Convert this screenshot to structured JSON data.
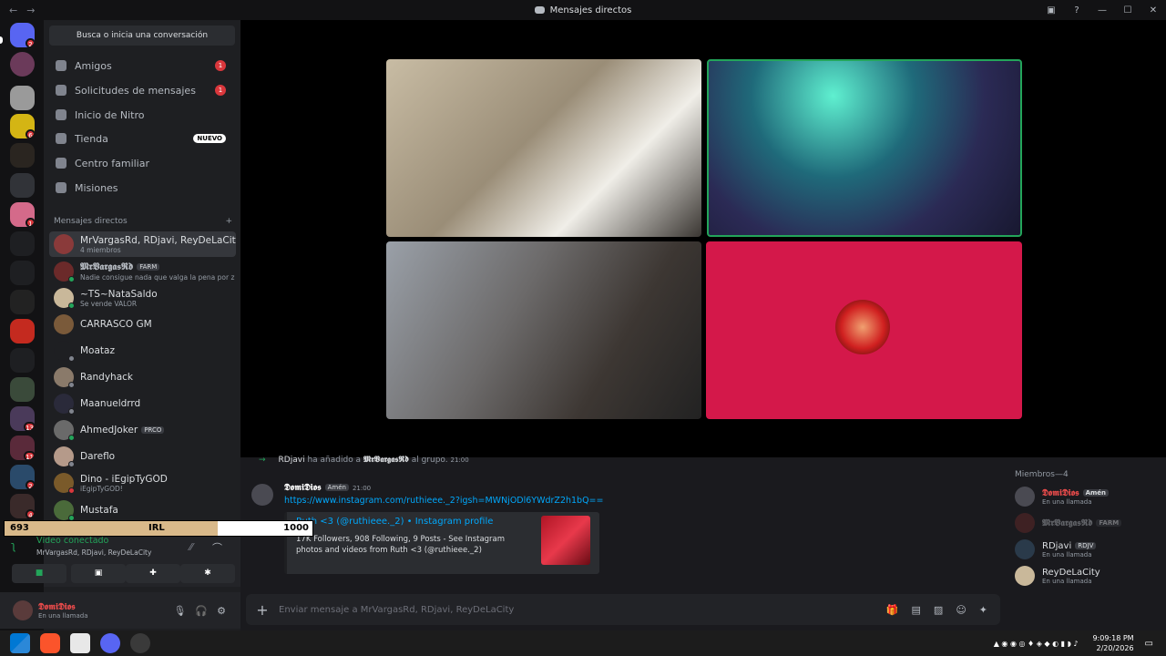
{
  "titlebar": {
    "title": "Mensajes directos",
    "back": "←",
    "forward": "→"
  },
  "search": {
    "placeholder": "Busca o inicia una conversación"
  },
  "nav": [
    {
      "label": "Amigos",
      "count": "1"
    },
    {
      "label": "Solicitudes de mensajes",
      "count": "1"
    },
    {
      "label": "Inicio de Nitro"
    },
    {
      "label": "Tienda",
      "badge": "NUEVO"
    },
    {
      "label": "Centro familiar"
    },
    {
      "label": "Misiones"
    }
  ],
  "dm_header": "Mensajes directos",
  "dms": [
    {
      "name": "MrVargasRd, RDjavi, ReyDeLaCity",
      "sub": "4 miembros"
    },
    {
      "name": "𝕸𝖗𝖁𝖆𝖗𝖌𝖆𝖘𝕽𝖉",
      "tag": "FARM",
      "sub": "Nadie consigue nada que valga la pena por z"
    },
    {
      "name": "~TS~NataSaldo",
      "sub": "Se vende VALOR"
    },
    {
      "name": "CARRASCO GM"
    },
    {
      "name": "Moataz"
    },
    {
      "name": "Randyhack"
    },
    {
      "name": "Maanueldrrd"
    },
    {
      "name": "AhmedJoker",
      "tag": "PRCO"
    },
    {
      "name": "Dareflo"
    },
    {
      "name": "Dino - iEgipTyGOD",
      "sub": "iEgipTyGOD!"
    },
    {
      "name": "Mustafa"
    }
  ],
  "voice": {
    "status": "Vídeo conectado",
    "channel": "MrVargasRd, RDjavi, ReyDeLaCity"
  },
  "user": {
    "name": "𝕯𝖔𝖒𝖎𝕯𝖎𝖔𝖘",
    "status": "En una llamada"
  },
  "progress": {
    "left": "693",
    "center": "IRL",
    "right": "1000",
    "value": 693,
    "max": 1000
  },
  "chat": {
    "system_actor": "RDjavi",
    "system_text": "ha añadido a",
    "system_target": "𝕸𝖗𝖁𝖆𝖗𝖌𝖆𝖘𝕽𝖉",
    "system_suffix": "al grupo.",
    "system_time": "21:00",
    "author": "𝕯𝖔𝖒𝖎𝕯𝖎𝖔𝖘",
    "author_tag": "Amén",
    "time": "21:00",
    "link": "https://www.instagram.com/ruthieee._2?igsh=MWNjODl6YWdrZ2h1bQ==",
    "embed_title": "Ruth <3 (@ruthieee._2) • Instagram profile",
    "embed_desc": "17K Followers, 908 Following, 9 Posts - See Instagram photos and videos from Ruth <3 (@ruthieee._2)"
  },
  "composer": {
    "placeholder": "Enviar mensaje a MrVargasRd, RDjavi, ReyDeLaCity"
  },
  "members": {
    "header": "Miembros—4",
    "list": [
      {
        "name": "𝕯𝖔𝖒𝖎𝕯𝖎𝖔𝖘",
        "tag": "Amén",
        "sub": "En una llamada",
        "color": "#e94b4b"
      },
      {
        "name": "𝕸𝖗𝖁𝖆𝖗𝖌𝖆𝖘𝕽𝖉",
        "tag": "FARM",
        "sub": "",
        "color": "#6b3a3a"
      },
      {
        "name": "RDjavi",
        "tag": "RDJV",
        "sub": "En una llamada",
        "color": "#dbdee1"
      },
      {
        "name": "ReyDeLaCity",
        "sub": "En una llamada",
        "color": "#dbdee1"
      }
    ]
  },
  "taskbar": {
    "time": "9:09:18 PM",
    "date": "2/20/2026"
  },
  "colors": {
    "accent": "#5865f2",
    "online": "#23a55a",
    "danger": "#da373c",
    "link": "#00a8fc",
    "tile_pink": "#d4184a"
  }
}
